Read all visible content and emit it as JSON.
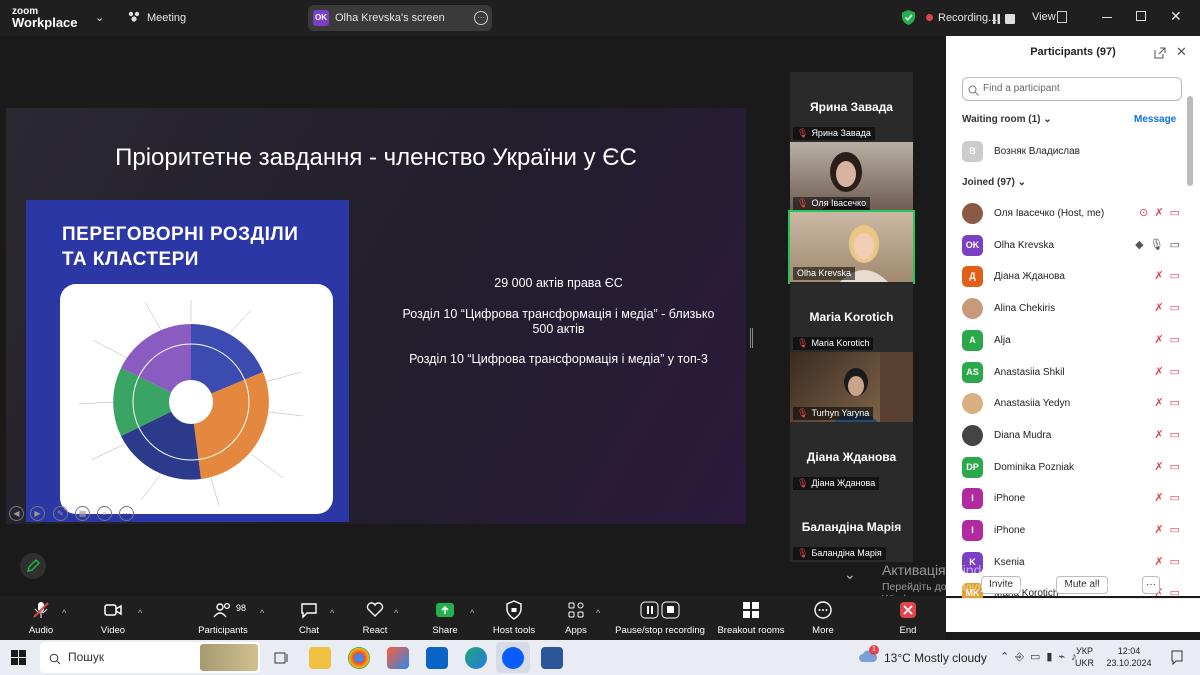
{
  "topbar": {
    "logo_line1": "zoom",
    "logo_line2": "Workplace",
    "meeting_label": "Meeting",
    "screen_badge": "OK",
    "screen_label": "Olha Krevska's screen",
    "recording_label": "Recording...",
    "view_label": "View"
  },
  "slide": {
    "title": "Пріоритетне завдання - членство України у ЄС",
    "infographic_title_line1": "ПЕРЕГОВОРНІ РОЗДІЛИ",
    "infographic_title_line2": "ТА КЛАСТЕРИ",
    "line1": "29 000 актів права ЄС",
    "line2a": "Розділ  10 “Цифрова трансформація і медіа” - близько",
    "line2b": "500 актів",
    "line3": "Розділ  10 “Цифрова трансформація і медіа” у топ-3"
  },
  "gallery": [
    {
      "big_name": "Ярина Завада",
      "label": "Ярина Завада",
      "video": false
    },
    {
      "big_name": "",
      "label": "Оля Івасечко",
      "video": true
    },
    {
      "big_name": "",
      "label": "Olha Krevska",
      "video": true,
      "active": true
    },
    {
      "big_name": "Maria Korotich",
      "label": "Maria Korotich",
      "video": false
    },
    {
      "big_name": "",
      "label": "Turhyn Yaryna",
      "video": true
    },
    {
      "big_name": "Діана Жданова",
      "label": "Діана Жданова",
      "video": false
    },
    {
      "big_name": "Баландіна Марія",
      "label": "Баландіна Марія",
      "video": false
    }
  ],
  "panel": {
    "title": "Participants (97)",
    "search_placeholder": "Find a participant",
    "waiting_label": "Waiting room (1)",
    "message_label": "Message",
    "waiting_person": {
      "initial": "В",
      "name": "Возняк Владислав"
    },
    "joined_label": "Joined (97)",
    "participants": [
      {
        "initial": "",
        "name": "Оля Івасечко (Host, me)",
        "color": "#8a5a44"
      },
      {
        "initial": "OK",
        "name": "Olha Krevska",
        "color": "#7b3fc4"
      },
      {
        "initial": "Д",
        "name": "Діана Жданова",
        "color": "#e0601a"
      },
      {
        "initial": "",
        "name": "Alina Chekiris",
        "color": "#c89a7a"
      },
      {
        "initial": "A",
        "name": "Alja",
        "color": "#2aa84a"
      },
      {
        "initial": "AS",
        "name": "Anastasiia Shkil",
        "color": "#2aa84a"
      },
      {
        "initial": "",
        "name": "Anastasiia Yedyn",
        "color": "#d8b080"
      },
      {
        "initial": "",
        "name": "Diana Mudra",
        "color": "#444444"
      },
      {
        "initial": "DP",
        "name": "Dominika Pozniak",
        "color": "#2aa84a"
      },
      {
        "initial": "I",
        "name": "iPhone",
        "color": "#b02aa0"
      },
      {
        "initial": "I",
        "name": "iPhone",
        "color": "#b02aa0"
      },
      {
        "initial": "K",
        "name": "Ksenia",
        "color": "#7b3fc4"
      },
      {
        "initial": "MK",
        "name": "Maria Korotich",
        "color": "#e0a030"
      }
    ],
    "invite_label": "Invite",
    "muteall_label": "Mute all",
    "more_label": "···"
  },
  "toolbar": {
    "audio": "Audio",
    "video": "Video",
    "participants": "Participants",
    "participants_count": "98",
    "chat": "Chat",
    "react": "React",
    "share": "Share",
    "hosttools": "Host tools",
    "apps": "Apps",
    "record": "Pause/stop recording",
    "breakout": "Breakout rooms",
    "more": "More",
    "end": "End"
  },
  "watermark": {
    "line1": "Активація Windows",
    "line2": "Перейдіть до розділу \"Настройки\", щоб активувати",
    "line3": "Windows."
  },
  "taskbar": {
    "search_label": "Пошук",
    "weather_temp": "13°C",
    "weather_desc": "Mostly cloudy",
    "lang1": "УКР",
    "lang2": "UKR",
    "time": "12:04",
    "date": "23.10.2024",
    "weather_badge": "1"
  },
  "colors": {
    "accent": "#0e71eb",
    "share_green": "#22b14c",
    "end_red": "#e0454b",
    "infographic_blue": "#2c37a6"
  }
}
